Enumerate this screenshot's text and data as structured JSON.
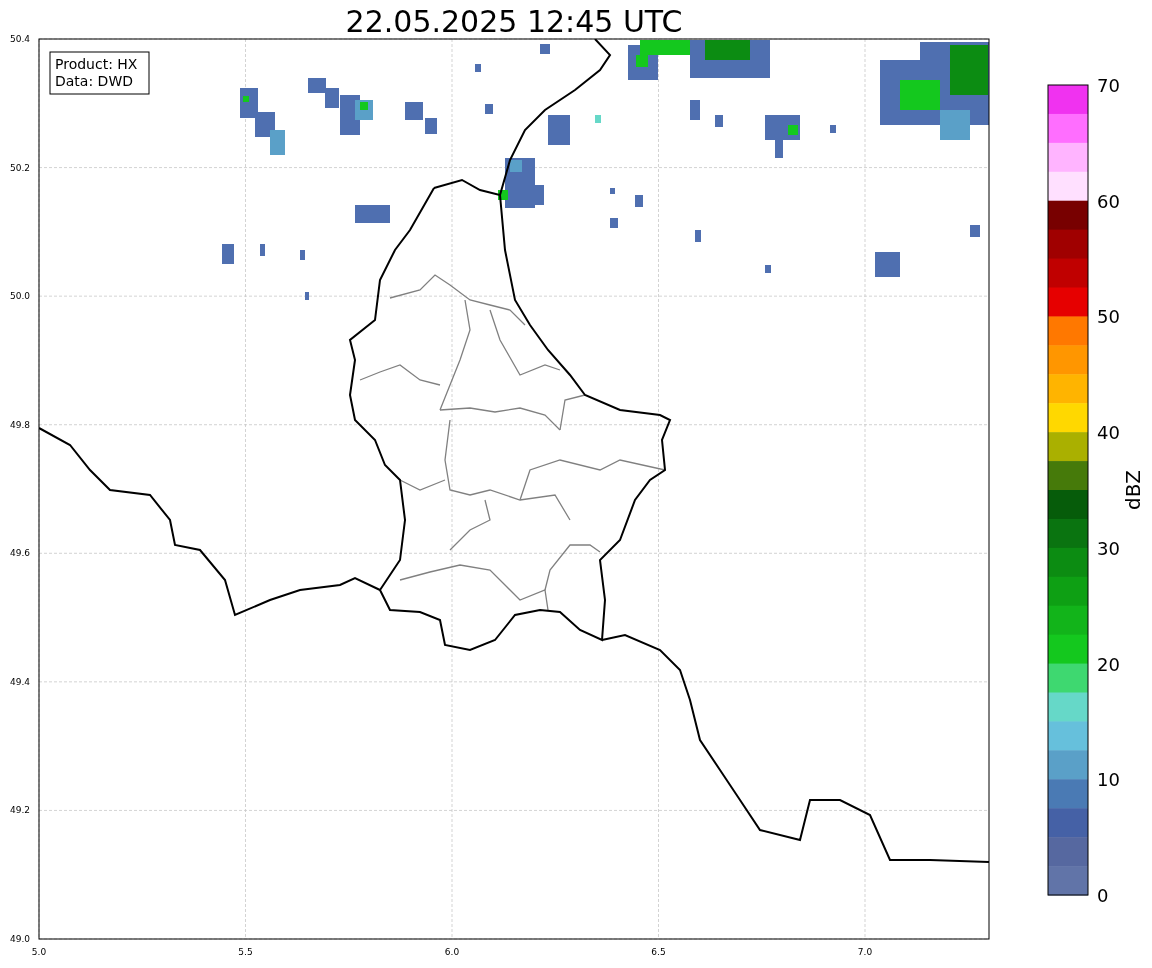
{
  "title": "22.05.2025 12:45 UTC",
  "legend": [
    "Product: HX",
    "Data: DWD"
  ],
  "x_ticks": [
    "5.0",
    "5.5",
    "6.0",
    "6.5",
    "7.0"
  ],
  "y_ticks": [
    "50.4",
    "50.2",
    "50.0",
    "49.8",
    "49.6",
    "49.4",
    "49.2",
    "49.0"
  ],
  "colorbar": {
    "label": "dBZ",
    "ticks": [
      "70",
      "60",
      "50",
      "40",
      "30",
      "20",
      "10",
      "0"
    ],
    "bands": [
      {
        "color": "#f032f0"
      },
      {
        "color": "#ff6eff"
      },
      {
        "color": "#ffb4ff"
      },
      {
        "color": "#ffe0ff"
      },
      {
        "color": "#780000"
      },
      {
        "color": "#a00000"
      },
      {
        "color": "#c00000"
      },
      {
        "color": "#e60000"
      },
      {
        "color": "#ff7800"
      },
      {
        "color": "#ff9600"
      },
      {
        "color": "#ffb400"
      },
      {
        "color": "#ffd800"
      },
      {
        "color": "#aab000"
      },
      {
        "color": "#467a0a"
      },
      {
        "color": "#065c0a"
      },
      {
        "color": "#0a7410"
      },
      {
        "color": "#0c8c12"
      },
      {
        "color": "#0ea014"
      },
      {
        "color": "#12b41a"
      },
      {
        "color": "#14c81e"
      },
      {
        "color": "#3ed870"
      },
      {
        "color": "#66d8c8"
      },
      {
        "color": "#66c0dc"
      },
      {
        "color": "#5aa0c8"
      },
      {
        "color": "#4a7ab4"
      },
      {
        "color": "#4561a6"
      },
      {
        "color": "#5668a0"
      },
      {
        "color": "#6174a8"
      }
    ]
  }
}
